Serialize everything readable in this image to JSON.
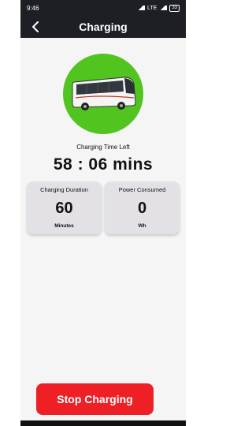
{
  "status_bar": {
    "time": "9:46",
    "icons_text": "LTE",
    "battery": "33"
  },
  "app_bar": {
    "title": "Charging",
    "back_icon": "chevron-left-icon"
  },
  "hero": {
    "icon": "bus-icon",
    "circle_color": "#52c41f"
  },
  "time_left": {
    "label": "Charging Time Left",
    "value": "58 : 06 mins"
  },
  "cards": [
    {
      "title": "Charging Duration",
      "value": "60",
      "unit": "Minutes"
    },
    {
      "title": "Power Consumed",
      "value": "0",
      "unit": "Wh"
    }
  ],
  "actions": {
    "stop_label": "Stop Charging",
    "stop_color": "#ee1f25"
  }
}
